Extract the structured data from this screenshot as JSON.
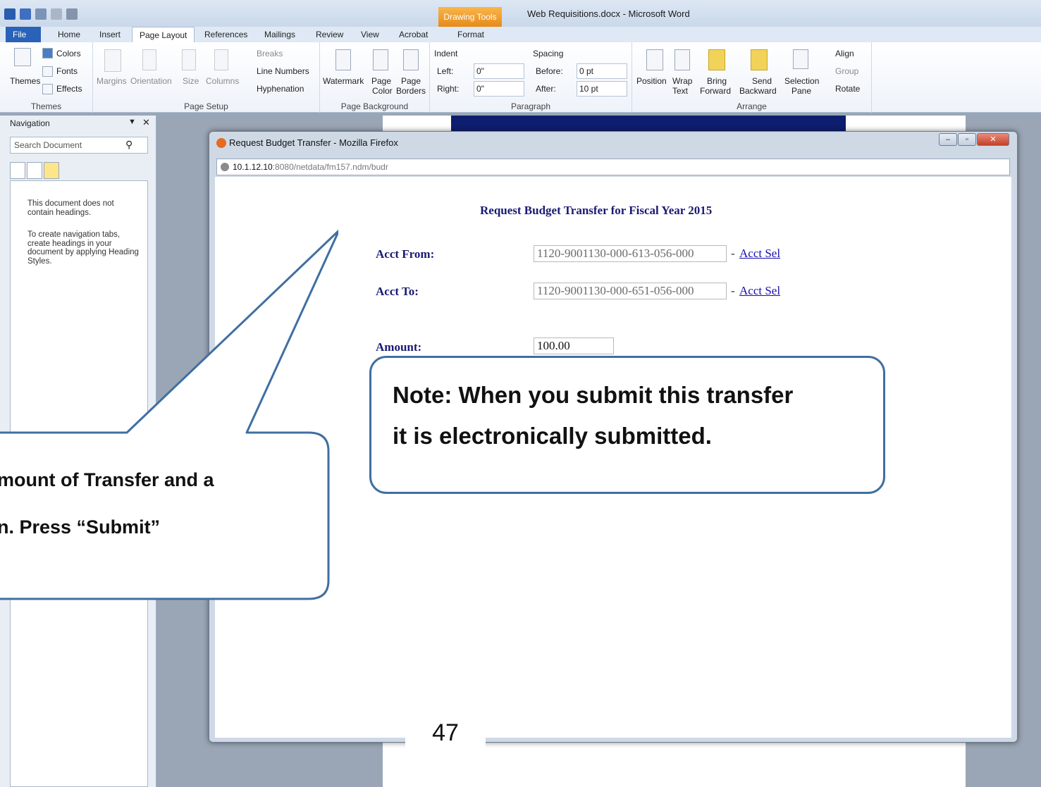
{
  "word": {
    "window_title": "Web Requisitions.docx - Microsoft Word",
    "contextual_tab": "Drawing Tools",
    "tabs": [
      "File",
      "Home",
      "Insert",
      "Page Layout",
      "References",
      "Mailings",
      "Review",
      "View",
      "Acrobat",
      "Format"
    ],
    "active_tab": "Page Layout",
    "ribbon": {
      "themes": {
        "themes_label": "Themes",
        "colors": "Colors",
        "fonts": "Fonts",
        "effects": "Effects",
        "group": "Themes"
      },
      "page_setup": {
        "margins": "Margins",
        "orientation": "Orientation",
        "size": "Size",
        "columns": "Columns",
        "breaks": "Breaks",
        "line_numbers": "Line Numbers",
        "hyphenation": "Hyphenation",
        "group": "Page Setup"
      },
      "page_background": {
        "watermark": "Watermark",
        "page_color": "Page",
        "page_color2": "Color",
        "page_borders": "Page",
        "page_borders2": "Borders",
        "group": "Page Background"
      },
      "paragraph": {
        "indent": "Indent",
        "left_label": "Left:",
        "left_value": "0\"",
        "right_label": "Right:",
        "right_value": "0\"",
        "spacing": "Spacing",
        "before_label": "Before:",
        "before_value": "0 pt",
        "after_label": "After:",
        "after_value": "10 pt",
        "group": "Paragraph"
      },
      "arrange": {
        "position": "Position",
        "wrap": "Wrap",
        "wrap2": "Text",
        "bring": "Bring",
        "bring2": "Forward",
        "send": "Send",
        "send2": "Backward",
        "selection": "Selection",
        "selection2": "Pane",
        "align": "Align",
        "group_btn": "Group",
        "rotate": "Rotate",
        "group": "Arrange"
      }
    },
    "navigation": {
      "title": "Navigation",
      "search_placeholder": "Search Document",
      "message1": "This document does not contain headings.",
      "message2": "To create navigation tabs, create headings in your document by applying Heading Styles."
    },
    "page_number": "47"
  },
  "firefox": {
    "title": "Request Budget Transfer - Mozilla Firefox",
    "url_host": "10.1.12.10",
    "url_rest": ":8080/netdata/fm157.ndm/budr",
    "heading": "Request Budget Transfer for Fiscal Year 2015",
    "acct_from_label": "Acct From:",
    "acct_from_value": "1120-9001130-000-613-056-000",
    "acct_to_label": "Acct To:",
    "acct_to_value": "1120-9001130-000-651-056-000",
    "acct_sel": "Acct Sel",
    "separator": "-",
    "amount_label": "Amount:",
    "amount_value": "100.00"
  },
  "callouts": {
    "note_line1": "Note: When you submit this transfer",
    "note_line2": "it is electronically submitted.",
    "left_line1": "mount of Transfer and a",
    "left_line2": "n. Press “Submit”"
  }
}
